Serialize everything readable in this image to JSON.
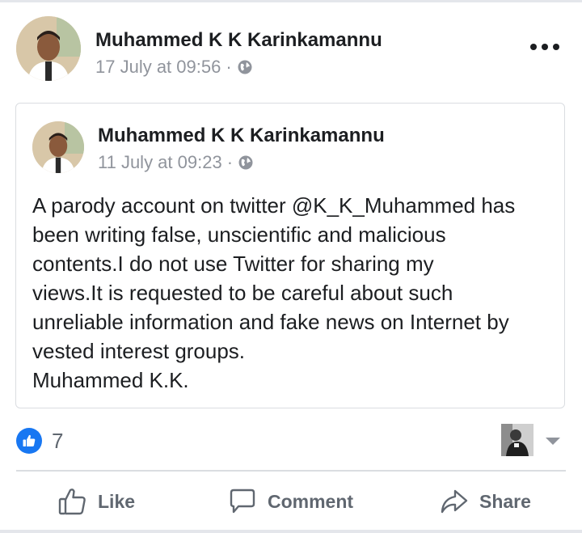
{
  "post": {
    "author": "Muhammed K K Karinkamannu",
    "timestamp": "17 July at 09:56",
    "separator": "·",
    "privacy_icon": "globe-icon",
    "more_icon": "more-options-icon"
  },
  "shared_post": {
    "author": "Muhammed K K Karinkamannu",
    "timestamp": "11 July at 09:23",
    "separator": "·",
    "privacy_icon": "globe-icon",
    "text_lines": [
      "A parody account on twitter @K_K_Muhammed has",
      "been writing false, unscientific and malicious",
      "contents.I do not use Twitter for sharing my",
      "views.It is requested to be careful about such",
      "unreliable information and fake news on Internet by",
      "vested interest groups.",
      "Muhammed K.K."
    ]
  },
  "reactions": {
    "icon": "like-reaction-icon",
    "count": "7"
  },
  "actions": {
    "like": "Like",
    "comment": "Comment",
    "share": "Share"
  },
  "colors": {
    "brand_blue": "#1877f2",
    "text_primary": "#1c1e21",
    "text_secondary": "#90949c",
    "action_text": "#606770",
    "border": "#dadde1"
  }
}
